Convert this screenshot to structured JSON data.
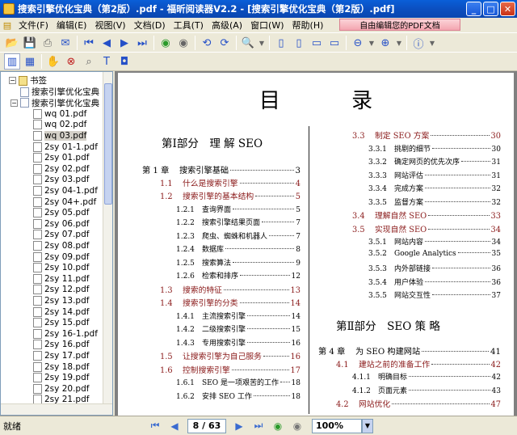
{
  "window": {
    "title": "搜索引擎优化宝典（第2版）.pdf - 福昕阅读器V2.2 - [搜索引擎优化宝典（第2版）.pdf]"
  },
  "menu": {
    "items": [
      "文件(F)",
      "编辑(E)",
      "视图(V)",
      "文档(D)",
      "工具(T)",
      "高级(A)",
      "窗口(W)",
      "帮助(H)"
    ],
    "promo": "自由编辑您的PDF文档"
  },
  "sidebar": {
    "root": "书签",
    "bookmarks": [
      "搜索引擎优化宝典",
      "搜索引擎优化宝典"
    ],
    "files": [
      "wq 01.pdf",
      "wq 02.pdf",
      "wq 03.pdf",
      "2sy 01-1.pdf",
      "2sy 01.pdf",
      "2sy 02.pdf",
      "2sy 03.pdf",
      "2sy 04-1.pdf",
      "2sy 04+.pdf",
      "2sy 05.pdf",
      "2sy 06.pdf",
      "2sy 07.pdf",
      "2sy 08.pdf",
      "2sy 09.pdf",
      "2sy 10.pdf",
      "2sy 11.pdf",
      "2sy 12.pdf",
      "2sy 13.pdf",
      "2sy 14.pdf",
      "2sy 15.pdf",
      "2sy 16-1.pdf",
      "2sy 16.pdf",
      "2sy 17.pdf",
      "2sy 18.pdf",
      "2sy 19.pdf",
      "2sy 20.pdf",
      "2sy 21.pdf"
    ],
    "selected_index": 2
  },
  "document": {
    "title": "目 录",
    "left_part": "第Ⅰ部分　理 解 SEO",
    "left_toc": [
      {
        "num": "第 1 章",
        "title": "搜索引擎基础",
        "page": "3",
        "level": "chap"
      },
      {
        "num": "1.1",
        "title": "什么是搜索引擎",
        "page": "4",
        "level": "sec"
      },
      {
        "num": "1.2",
        "title": "搜索引擎的基本结构",
        "page": "5",
        "level": "sec"
      },
      {
        "num": "1.2.1",
        "title": "查询界面",
        "page": "5",
        "level": "sub"
      },
      {
        "num": "1.2.2",
        "title": "搜索引擎结果页面",
        "page": "7",
        "level": "sub"
      },
      {
        "num": "1.2.3",
        "title": "爬虫、蜘蛛和机器人",
        "page": "7",
        "level": "sub"
      },
      {
        "num": "1.2.4",
        "title": "数据库",
        "page": "8",
        "level": "sub"
      },
      {
        "num": "1.2.5",
        "title": "搜索算法",
        "page": "9",
        "level": "sub"
      },
      {
        "num": "1.2.6",
        "title": "检索和排序",
        "page": "12",
        "level": "sub"
      },
      {
        "num": "1.3",
        "title": "搜索的特征",
        "page": "13",
        "level": "sec"
      },
      {
        "num": "1.4",
        "title": "搜索引擎的分类",
        "page": "14",
        "level": "sec"
      },
      {
        "num": "1.4.1",
        "title": "主流搜索引擎",
        "page": "14",
        "level": "sub"
      },
      {
        "num": "1.4.2",
        "title": "二级搜索引擎",
        "page": "15",
        "level": "sub"
      },
      {
        "num": "1.4.3",
        "title": "专用搜索引擎",
        "page": "16",
        "level": "sub"
      },
      {
        "num": "1.5",
        "title": "让搜索引擎为自己服务",
        "page": "16",
        "level": "sec"
      },
      {
        "num": "1.6",
        "title": "控制搜索引擎",
        "page": "17",
        "level": "sec"
      },
      {
        "num": "1.6.1",
        "title": "SEO 是一项艰苦的工作",
        "page": "18",
        "level": "sub"
      },
      {
        "num": "1.6.2",
        "title": "安排 SEO 工作",
        "page": "18",
        "level": "sub"
      }
    ],
    "right_toc_a": [
      {
        "num": "3.3",
        "title": "制定 SEO 方案",
        "page": "30",
        "level": "sec"
      },
      {
        "num": "3.3.1",
        "title": "挑剔的细节",
        "page": "30",
        "level": "sub"
      },
      {
        "num": "3.3.2",
        "title": "确定网页的优先次序",
        "page": "31",
        "level": "sub"
      },
      {
        "num": "3.3.3",
        "title": "网站评估",
        "page": "31",
        "level": "sub"
      },
      {
        "num": "3.3.4",
        "title": "完成方案",
        "page": "32",
        "level": "sub"
      },
      {
        "num": "3.3.5",
        "title": "监督方案",
        "page": "32",
        "level": "sub"
      },
      {
        "num": "3.4",
        "title": "理解自然 SEO",
        "page": "33",
        "level": "sec"
      },
      {
        "num": "3.5",
        "title": "实现自然 SEO",
        "page": "34",
        "level": "sec"
      },
      {
        "num": "3.5.1",
        "title": "网站内容",
        "page": "34",
        "level": "sub"
      },
      {
        "num": "3.5.2",
        "title": "Google Analytics",
        "page": "35",
        "level": "sub"
      },
      {
        "num": "3.5.3",
        "title": "内外部链接",
        "page": "36",
        "level": "sub"
      },
      {
        "num": "3.5.4",
        "title": "用户体验",
        "page": "36",
        "level": "sub"
      },
      {
        "num": "3.5.5",
        "title": "网站交互性",
        "page": "37",
        "level": "sub"
      }
    ],
    "right_part": "第Ⅱ部分　SEO 策 略",
    "right_toc_b": [
      {
        "num": "第 4 章",
        "title": "为 SEO 构建网站",
        "page": "41",
        "level": "chap"
      },
      {
        "num": "4.1",
        "title": "建站之前的准备工作",
        "page": "42",
        "level": "sec"
      },
      {
        "num": "4.1.1",
        "title": "明确目标",
        "page": "42",
        "level": "sub"
      },
      {
        "num": "4.1.2",
        "title": "页面元素",
        "page": "43",
        "level": "sub"
      },
      {
        "num": "4.2",
        "title": "网站优化",
        "page": "47",
        "level": "sec"
      }
    ]
  },
  "status": {
    "text": "就绪",
    "page_field": "8 / 63",
    "zoom": "100%"
  }
}
